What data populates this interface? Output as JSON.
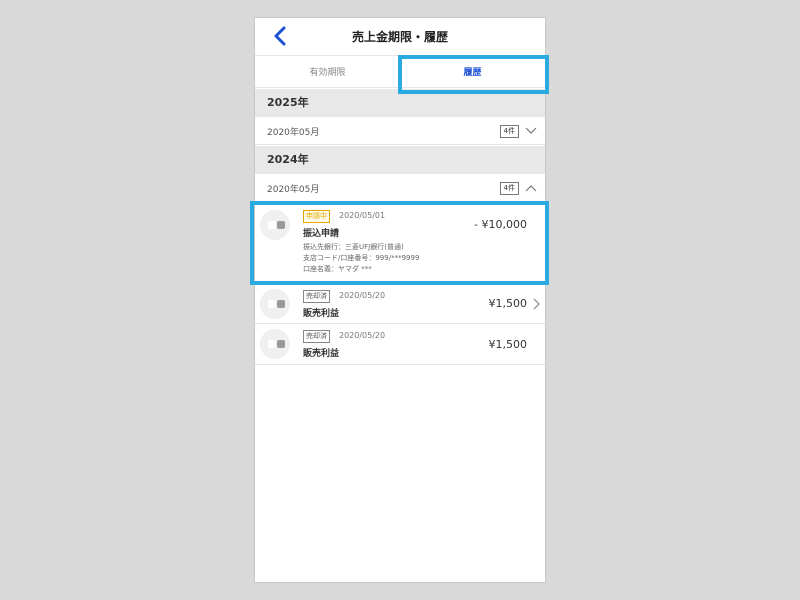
{
  "header": {
    "title": "売上金期限・履歴",
    "back_icon": "chevron-left-icon"
  },
  "tabs": [
    {
      "label": "有効期限",
      "active": false
    },
    {
      "label": "履歴",
      "active": true
    }
  ],
  "years": [
    {
      "year": "2025年",
      "month": "2020年05月",
      "count": "4件",
      "expanded": false
    },
    {
      "year": "2024年",
      "month": "2020年05月",
      "count": "4件",
      "expanded": true
    }
  ],
  "items": [
    {
      "status": "申請中",
      "status_type": "pending",
      "date": "2020/05/01",
      "title": "振込申請",
      "amount": "- ¥10,000",
      "details": [
        "振込先銀行：三菱UFJ銀行(普通)",
        "支店コード/口座番号：999/***9999",
        "口座名義：ヤマダ ***"
      ]
    },
    {
      "status": "売却済",
      "status_type": "sold",
      "date": "2020/05/20",
      "title": "販売利益",
      "amount": "¥1,500",
      "has_arrow": true
    },
    {
      "status": "売却済",
      "status_type": "sold",
      "date": "2020/05/20",
      "title": "販売利益",
      "amount": "¥1,500",
      "has_arrow": false
    }
  ],
  "colors": {
    "accent": "#1a4fd6",
    "highlight": "#29abe2",
    "pending": "#e0a800"
  }
}
